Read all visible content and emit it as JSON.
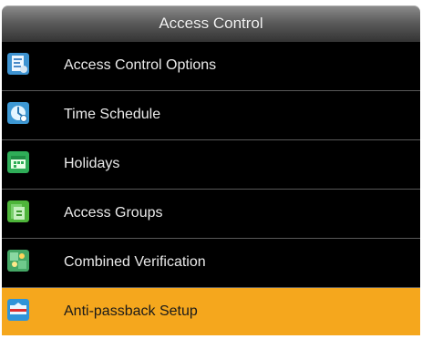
{
  "header": {
    "title": "Access Control"
  },
  "menu": {
    "items": [
      {
        "label": "Access Control Options",
        "icon": "document-settings-icon",
        "selected": false
      },
      {
        "label": "Time Schedule",
        "icon": "clock-icon",
        "selected": false
      },
      {
        "label": "Holidays",
        "icon": "calendar-icon",
        "selected": false
      },
      {
        "label": "Access Groups",
        "icon": "group-card-icon",
        "selected": false
      },
      {
        "label": "Combined Verification",
        "icon": "combined-verification-icon",
        "selected": false
      },
      {
        "label": "Anti-passback Setup",
        "icon": "anti-passback-icon",
        "selected": true
      }
    ],
    "selected_color": "#f5a71d",
    "background_color": "#000000",
    "text_color": "#eaeaea"
  }
}
